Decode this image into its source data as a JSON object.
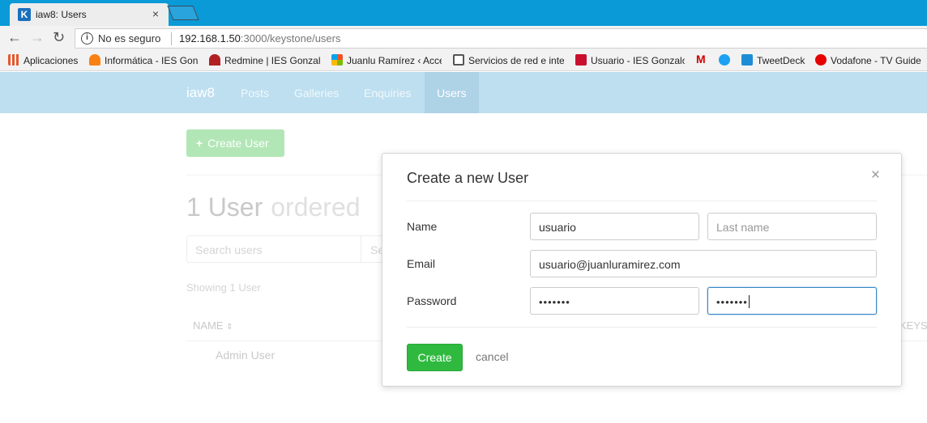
{
  "browser": {
    "tab_title": "iaw8: Users",
    "tab_favicon": "K",
    "tab_close": "×",
    "security_label": "No es seguro",
    "url_host": "192.168.1.50",
    "url_path": ":3000/keystone/users",
    "bookmarks": [
      {
        "label": "Aplicaciones",
        "icon": "apps-grid-icon",
        "color": "#e4572e"
      },
      {
        "label": "Informática - IES Gonz",
        "icon": "moodle-icon",
        "color": "#f98012"
      },
      {
        "label": "Redmine | IES Gonzalo",
        "icon": "redmine-icon",
        "color": "#b32024"
      },
      {
        "label": "Juanlu Ramírez ‹ Acce",
        "icon": "windows-icon",
        "color": "#7fba00"
      },
      {
        "label": "Servicios de red e inte",
        "icon": "building-icon",
        "color": "#555555"
      },
      {
        "label": "Usuario - IES Gonzalo",
        "icon": "square-logo-icon",
        "color": "#c8102e"
      },
      {
        "label": "",
        "icon": "m-logo-icon",
        "color": "#d00000"
      },
      {
        "label": "",
        "icon": "s-logo-icon",
        "color": "#1da1f2"
      },
      {
        "label": "TweetDeck",
        "icon": "tweetdeck-icon",
        "color": "#1d8dd6"
      },
      {
        "label": "Vodafone - TV Guide",
        "icon": "vodafone-icon",
        "color": "#e60000"
      }
    ]
  },
  "app_nav": {
    "brand": "iaw8",
    "links": [
      "Posts",
      "Galleries",
      "Enquiries",
      "Users"
    ],
    "active": "Users"
  },
  "page": {
    "create_button_icon": "+",
    "create_button": "Create User",
    "heading": "1 User",
    "heading_sub": "ordered",
    "search_placeholder": "Search users",
    "search_fragment": "Se",
    "showing": "Showing 1 User",
    "col_name": "NAME",
    "col_sort_icon": "⇕",
    "col_keys": "KEYS",
    "rows": [
      "Admin User"
    ]
  },
  "modal": {
    "title": "Create a new User",
    "close": "×",
    "labels": {
      "name": "Name",
      "email": "Email",
      "password": "Password"
    },
    "first_name": "usuario",
    "last_name_placeholder": "Last name",
    "email": "usuario@juanluramirez.com",
    "password": "•••••••",
    "password_confirm": "•••••••",
    "create": "Create",
    "cancel": "cancel"
  }
}
